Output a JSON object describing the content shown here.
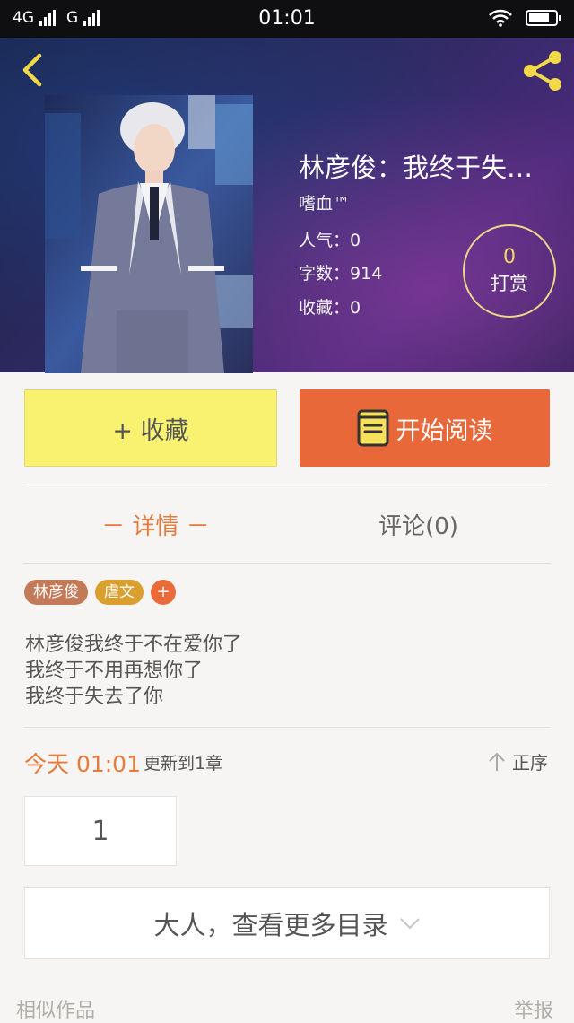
{
  "status_bar": {
    "network1": "4G",
    "network2": "G",
    "time": "01:01"
  },
  "book": {
    "title": "林彦俊：我终于失…",
    "author": "嗜血™",
    "popularity": "人气：0",
    "word_count": "字数：914",
    "favorites": "收藏：0",
    "reward_count": "0",
    "reward_label": "打赏"
  },
  "actions": {
    "collect_label": "+ 收藏",
    "read_label": "开始阅读"
  },
  "tabs": {
    "detail": "－ 详情 －",
    "comments": "评论(0)"
  },
  "tags": [
    {
      "label": "林彦俊",
      "color": "#c27a58"
    },
    {
      "label": "虐文",
      "color": "#d9a030"
    }
  ],
  "tag_add": "+",
  "description": [
    "林彦俊我终于不在爱你了",
    "我终于不用再想你了",
    "我终于失去了你"
  ],
  "update": {
    "time": "今天 01:01",
    "text": "更新到1章",
    "sort_label": "正序"
  },
  "chapters": [
    "1"
  ],
  "more_catalog": "大人，查看更多目录",
  "footer": {
    "similar": "相似作品",
    "report": "举报"
  },
  "colors": {
    "accent": "#e8683a",
    "collect_bg": "#f9f270",
    "gold": "#f3d56a"
  }
}
